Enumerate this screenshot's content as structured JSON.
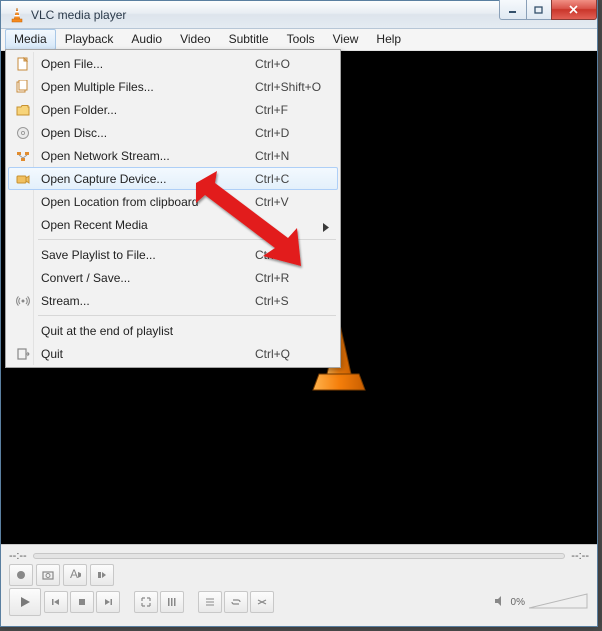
{
  "title": "VLC media player",
  "menubar": [
    "Media",
    "Playback",
    "Audio",
    "Video",
    "Subtitle",
    "Tools",
    "View",
    "Help"
  ],
  "dropdown": {
    "items": [
      {
        "icon": "file",
        "label": "Open File...",
        "shortcut": "Ctrl+O"
      },
      {
        "icon": "files",
        "label": "Open Multiple Files...",
        "shortcut": "Ctrl+Shift+O"
      },
      {
        "icon": "folder",
        "label": "Open Folder...",
        "shortcut": "Ctrl+F"
      },
      {
        "icon": "disc",
        "label": "Open Disc...",
        "shortcut": "Ctrl+D"
      },
      {
        "icon": "network",
        "label": "Open Network Stream...",
        "shortcut": "Ctrl+N"
      },
      {
        "icon": "capture",
        "label": "Open Capture Device...",
        "shortcut": "Ctrl+C",
        "hover": true
      },
      {
        "icon": "",
        "label": "Open Location from clipboard",
        "shortcut": "Ctrl+V"
      },
      {
        "icon": "",
        "label": "Open Recent Media",
        "shortcut": "",
        "submenu": true
      },
      {
        "sep": true
      },
      {
        "icon": "",
        "label": "Save Playlist to File...",
        "shortcut": "Ctrl+Y"
      },
      {
        "icon": "",
        "label": "Convert / Save...",
        "shortcut": "Ctrl+R"
      },
      {
        "icon": "stream",
        "label": "Stream...",
        "shortcut": "Ctrl+S"
      },
      {
        "sep": true
      },
      {
        "icon": "",
        "label": "Quit at the end of playlist",
        "shortcut": ""
      },
      {
        "icon": "quit",
        "label": "Quit",
        "shortcut": "Ctrl+Q"
      }
    ]
  },
  "seek": {
    "left": "--:--",
    "right": "--:--"
  },
  "volume": {
    "percent": "0%"
  }
}
